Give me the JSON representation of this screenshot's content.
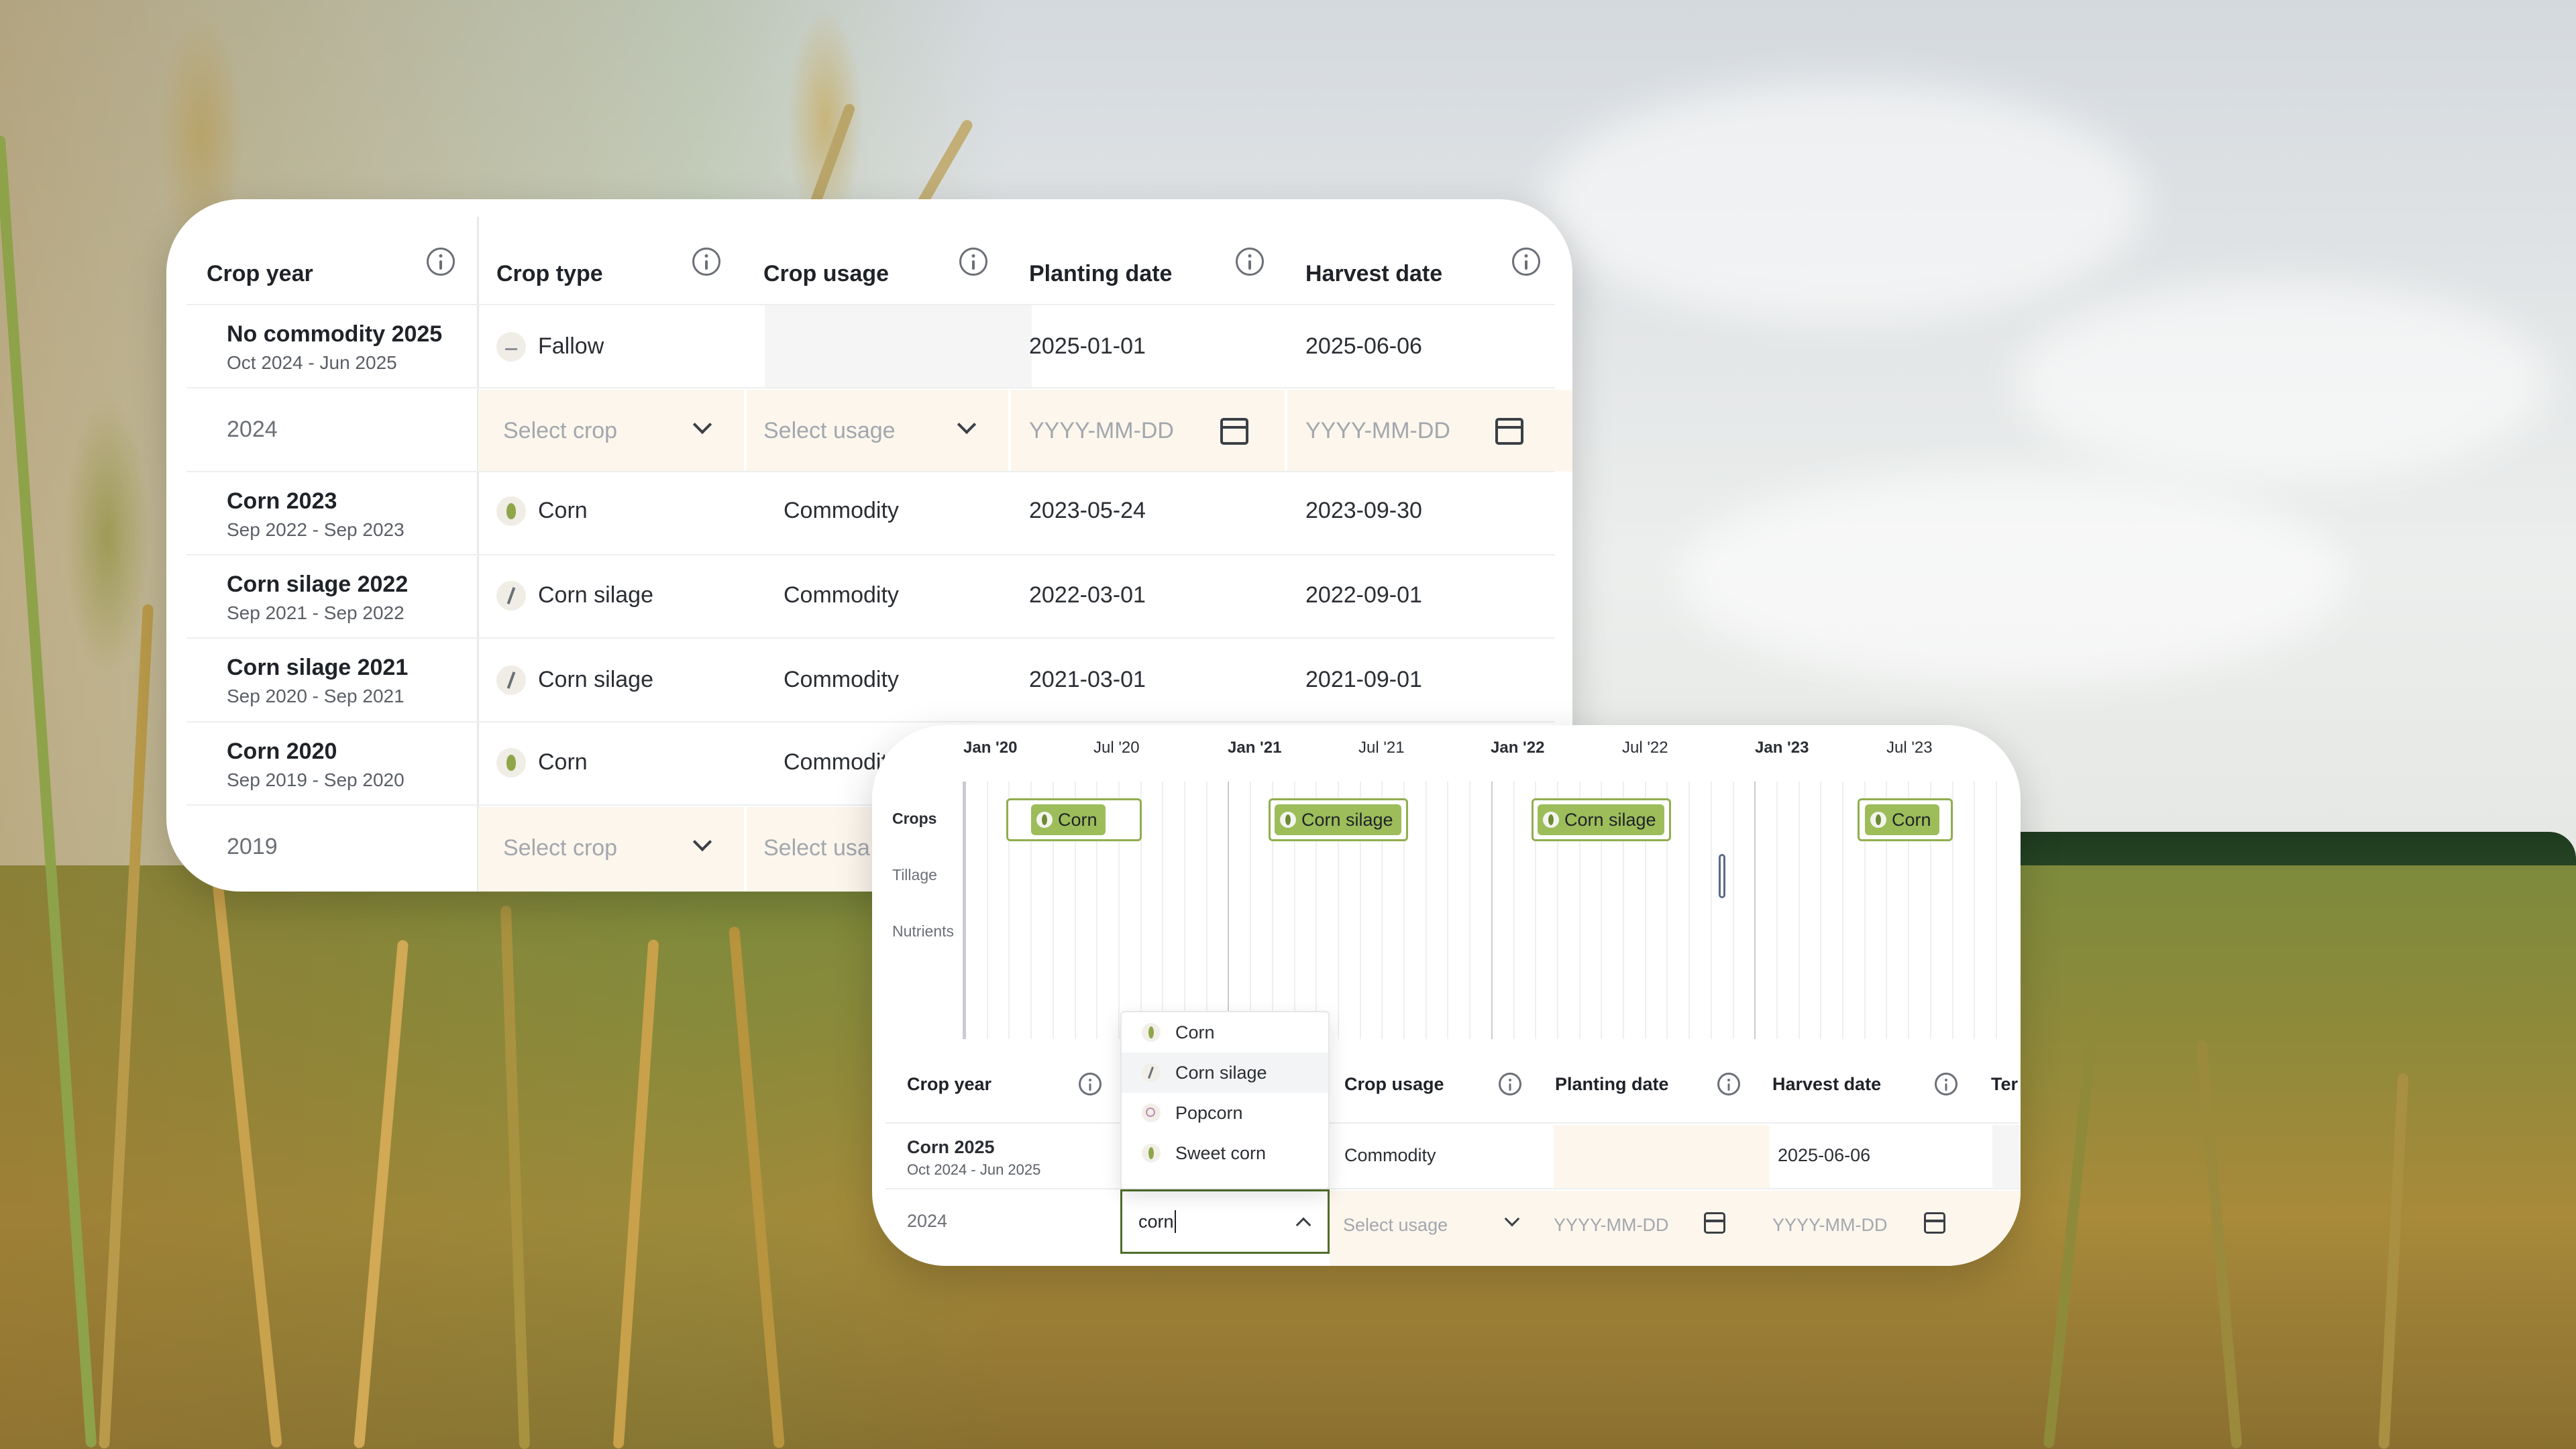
{
  "colors": {
    "accent_green": "#9cbd5a",
    "border_green": "#8fae4e",
    "input_border": "#4f6e2a",
    "row_highlight": "#fcf6ed"
  },
  "table1": {
    "headers": [
      "Crop year",
      "Crop type",
      "Crop usage",
      "Planting date",
      "Harvest date"
    ],
    "rows": [
      {
        "title": "No commodity 2025",
        "subtitle": "Oct 2024 - Jun 2025",
        "crop": "Fallow",
        "crop_icon": "fallow-icon",
        "usage": "",
        "planting": "2025-01-01",
        "harvest": "2025-06-06"
      },
      {
        "title": "2024",
        "crop_placeholder": "Select crop",
        "usage_placeholder": "Select usage",
        "planting_placeholder": "YYYY-MM-DD",
        "harvest_placeholder": "YYYY-MM-DD"
      },
      {
        "title": "Corn 2023",
        "subtitle": "Sep 2022 - Sep 2023",
        "crop": "Corn",
        "crop_icon": "corn-icon",
        "usage": "Commodity",
        "planting": "2023-05-24",
        "harvest": "2023-09-30"
      },
      {
        "title": "Corn silage 2022",
        "subtitle": "Sep 2021 - Sep 2022",
        "crop": "Corn silage",
        "crop_icon": "corn-silage-icon",
        "usage": "Commodity",
        "planting": "2022-03-01",
        "harvest": "2022-09-01"
      },
      {
        "title": "Corn silage 2021",
        "subtitle": "Sep 2020 - Sep 2021",
        "crop": "Corn silage",
        "crop_icon": "corn-silage-icon",
        "usage": "Commodity",
        "planting": "2021-03-01",
        "harvest": "2021-09-01"
      },
      {
        "title": "Corn 2020",
        "subtitle": "Sep 2019 - Sep 2020",
        "crop": "Corn",
        "crop_icon": "corn-icon",
        "usage": "Commodity"
      },
      {
        "title": "2019",
        "crop_placeholder": "Select crop",
        "usage_placeholder": "Select usa"
      }
    ]
  },
  "timeline": {
    "months": [
      "Jan '20",
      "Jul '20",
      "Jan '21",
      "Jul '21",
      "Jan '22",
      "Jul '22",
      "Jan '23",
      "Jul '23"
    ],
    "row_labels": [
      "Crops",
      "Tillage",
      "Nutrients"
    ],
    "crop_bars": [
      {
        "label": "Corn",
        "icon": "corn-icon"
      },
      {
        "label": "Corn silage",
        "icon": "corn-silage-icon"
      },
      {
        "label": "Corn silage",
        "icon": "corn-silage-icon"
      },
      {
        "label": "Corn",
        "icon": "corn-icon"
      }
    ]
  },
  "table2": {
    "headers": [
      "Crop year",
      "Crop usage",
      "Planting date",
      "Harvest date",
      "Ter"
    ],
    "row1": {
      "title": "Corn 2025",
      "subtitle": "Oct 2024 - Jun 2025",
      "usage": "Commodity",
      "harvest": "2025-06-06"
    },
    "row2": {
      "title": "2024",
      "crop_input_value": "corn",
      "usage_placeholder": "Select usage",
      "planting_placeholder": "YYYY-MM-DD",
      "harvest_placeholder": "YYYY-MM-DD"
    },
    "dropdown": [
      {
        "label": "Corn",
        "icon": "corn-icon"
      },
      {
        "label": "Corn silage",
        "icon": "corn-silage-icon"
      },
      {
        "label": "Popcorn",
        "icon": "popcorn-icon"
      },
      {
        "label": "Sweet corn",
        "icon": "sweet-corn-icon"
      }
    ]
  }
}
